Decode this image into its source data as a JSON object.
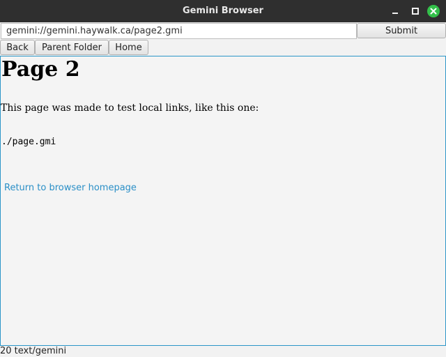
{
  "window": {
    "title": "Gemini Browser"
  },
  "address_bar": {
    "value": "gemini://gemini.haywalk.ca/page2.gmi",
    "submit_label": "Submit"
  },
  "nav": {
    "back_label": "Back",
    "parent_label": "Parent Folder",
    "home_label": "Home"
  },
  "page": {
    "heading": "Page 2",
    "paragraph": "This page was made to test local links, like this one:",
    "preformatted": "./page.gmi",
    "link_text": "Return to browser homepage"
  },
  "status_bar": {
    "text": "20 text/gemini"
  },
  "colors": {
    "titlebar": "#2f2f2f",
    "close_button": "#33c04a",
    "link": "#2a8fc7",
    "content_border": "#2b96c8"
  }
}
